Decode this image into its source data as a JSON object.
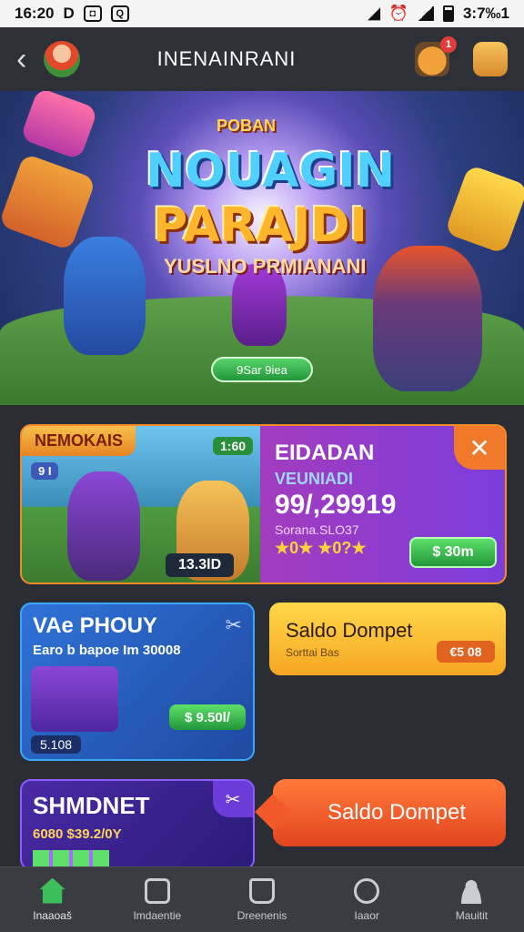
{
  "status_bar": {
    "time": "16:20",
    "left_letter": "D",
    "right_text": "3:7‰1"
  },
  "app_bar": {
    "title": "INENAINRANI",
    "bag_badge": "1"
  },
  "hero": {
    "small_title": "POBAN",
    "title_line1": "NOUAGIN",
    "title_line2": "PARAJDI",
    "tagline": "YUSLNO PRMIANANI",
    "button_label": "9Sar 9iea"
  },
  "featured_card": {
    "tag": "NEMOKAIS",
    "count_badge": "1:60",
    "small_badge": "9 I",
    "price_badge": "13.3lD",
    "name": "EIDADAN",
    "category": "VEUNIADI",
    "number": "99/,29919",
    "meta": "Sorana.SLO37",
    "rating": "★0★ ★0?★",
    "buy_label": "$ 30m"
  },
  "card_pphouy": {
    "title": "VAe PHOUY",
    "subtitle": "Earo b bapoe  Im 30008",
    "id_label": "5.108",
    "price_label": "$ 9.50l/"
  },
  "card_saldo": {
    "title": "Saldo Dompet",
    "subtitle": "Sorttai Bas",
    "price": "€5 08"
  },
  "card_shimdnet": {
    "title": "SHMDNET",
    "subtitle": "6080 $39.2/0Y"
  },
  "card_cta": {
    "label": "Saldo Dompet"
  },
  "tabs": [
    {
      "label": "Inaaoaš",
      "icon": "home-icon"
    },
    {
      "label": "Imdaentie",
      "icon": "search-icon"
    },
    {
      "label": "Dreenenis",
      "icon": "bag-icon"
    },
    {
      "label": "Iaaor",
      "icon": "search-icon"
    },
    {
      "label": "Mauitit",
      "icon": "user-icon"
    }
  ]
}
